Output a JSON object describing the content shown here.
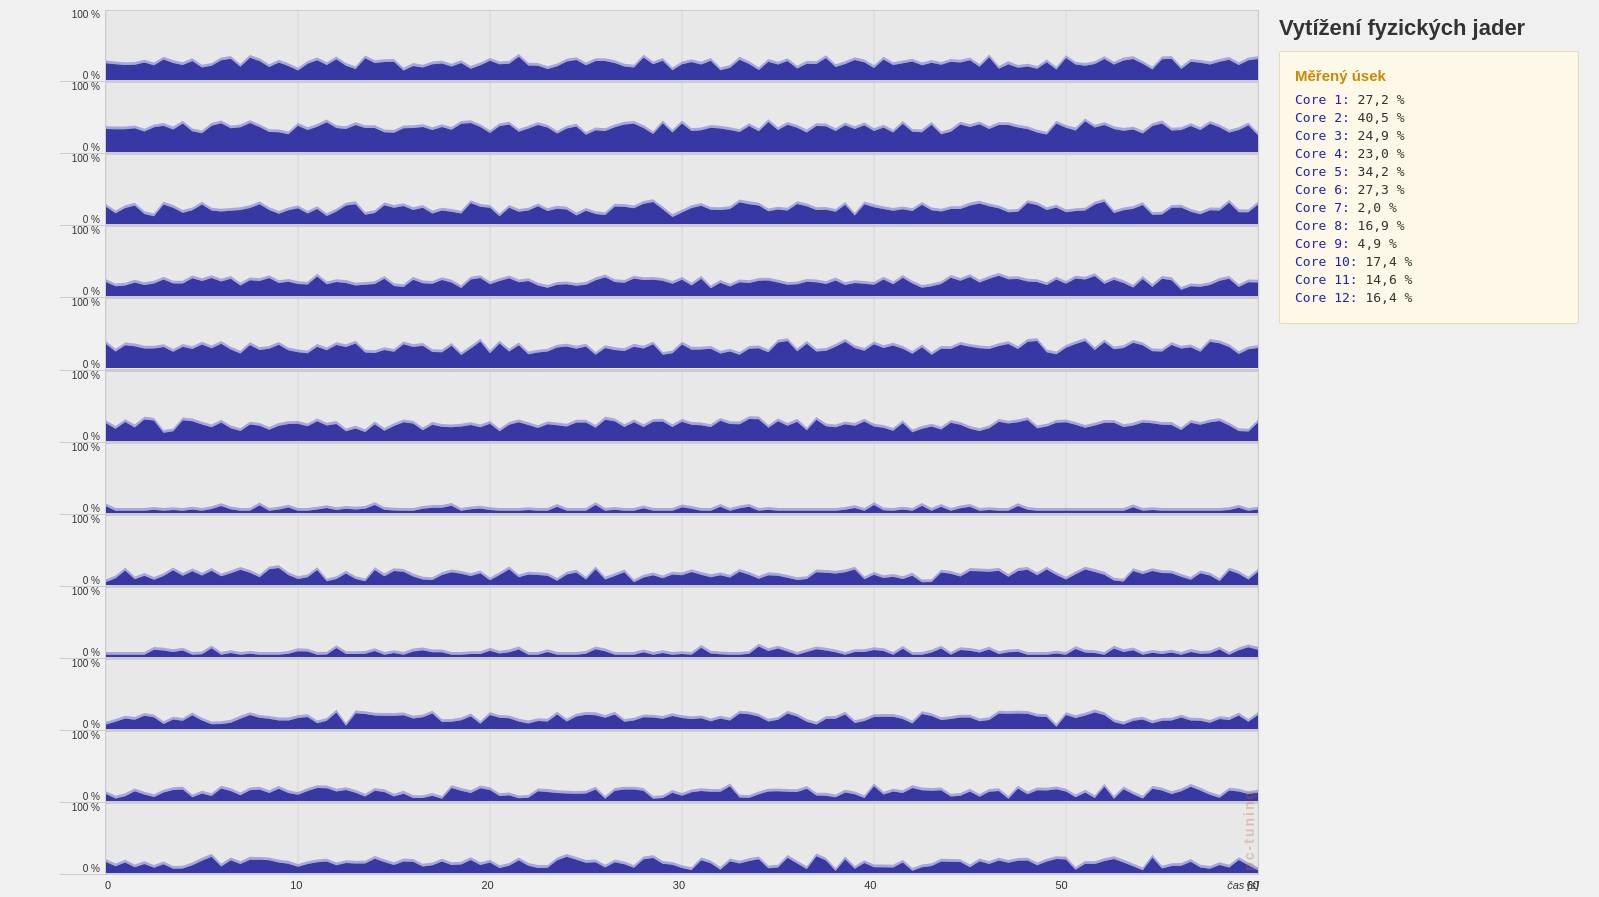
{
  "sidebar": {
    "title": "Vytížení fyzických jader",
    "measured_section": "Měřený úsek",
    "cores": [
      {
        "label": "Core  1:",
        "value": "27,2 %"
      },
      {
        "label": "Core  2:",
        "value": "40,5 %"
      },
      {
        "label": "Core  3:",
        "value": "24,9 %"
      },
      {
        "label": "Core  4:",
        "value": "23,0 %"
      },
      {
        "label": "Core  5:",
        "value": "34,2 %"
      },
      {
        "label": "Core  6:",
        "value": "27,3 %"
      },
      {
        "label": "Core  7:",
        "value": "2,0 %"
      },
      {
        "label": "Core  8:",
        "value": "16,9 %"
      },
      {
        "label": "Core  9:",
        "value": "4,9 %"
      },
      {
        "label": "Core 10:",
        "value": "17,4 %"
      },
      {
        "label": "Core 11:",
        "value": "14,6 %"
      },
      {
        "label": "Core 12:",
        "value": "16,4 %"
      }
    ]
  },
  "chart": {
    "y_top": "100 %",
    "y_bottom": "0 %",
    "x_ticks": [
      "0",
      "10",
      "20",
      "30",
      "40",
      "50",
      "60"
    ],
    "x_label": "čas [s]",
    "cores": [
      {
        "id": 1,
        "avg_pct": 27
      },
      {
        "id": 2,
        "avg_pct": 41
      },
      {
        "id": 3,
        "avg_pct": 25
      },
      {
        "id": 4,
        "avg_pct": 23
      },
      {
        "id": 5,
        "avg_pct": 34
      },
      {
        "id": 6,
        "avg_pct": 27
      },
      {
        "id": 7,
        "avg_pct": 2
      },
      {
        "id": 8,
        "avg_pct": 17
      },
      {
        "id": 9,
        "avg_pct": 5
      },
      {
        "id": 10,
        "avg_pct": 17
      },
      {
        "id": 11,
        "avg_pct": 15
      },
      {
        "id": 12,
        "avg_pct": 16
      }
    ]
  },
  "watermark": "pc-tuning"
}
